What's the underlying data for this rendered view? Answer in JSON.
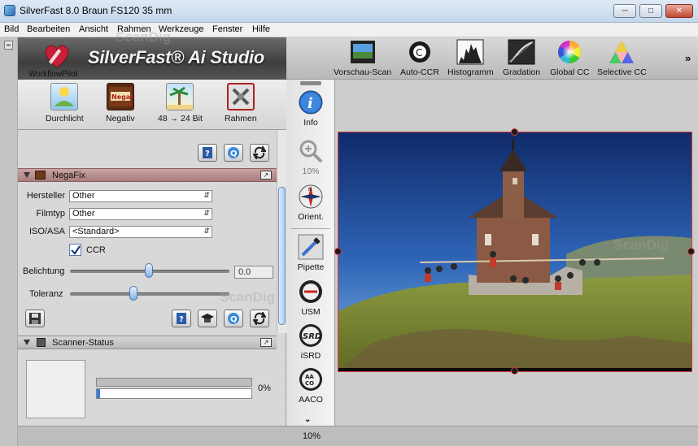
{
  "window": {
    "title": "SilverFast 8.0 Braun FS120 35 mm"
  },
  "menu": [
    "Bild",
    "Bearbeiten",
    "Ansicht",
    "Rahmen",
    "Werkzeuge",
    "Fenster",
    "Hilfe"
  ],
  "brand": {
    "logo_text": "SilverFast® Ai Studio",
    "workflow_label": "WorkflowPilot"
  },
  "toolbar": [
    {
      "label": "Vorschau-Scan",
      "icon": "preview-scan-icon"
    },
    {
      "label": "Auto-CCR",
      "icon": "auto-ccr-icon"
    },
    {
      "label": "Histogramm",
      "icon": "histogram-icon"
    },
    {
      "label": "Gradation",
      "icon": "gradation-icon"
    },
    {
      "label": "Global CC",
      "icon": "global-cc-icon"
    },
    {
      "label": "Selective CC",
      "icon": "selective-cc-icon"
    }
  ],
  "toolbar_more": "»",
  "scan_modes": [
    {
      "label": "Durchlicht",
      "icon": "transparency-icon"
    },
    {
      "label": "Negativ",
      "icon": "negafix-icon"
    },
    {
      "label": "48 → 24 Bit",
      "icon": "bitdepth-icon"
    },
    {
      "label": "Rahmen",
      "icon": "frame-tools-icon"
    }
  ],
  "negafix": {
    "title": "NegaFix",
    "hersteller_label": "Hersteller",
    "hersteller_value": "Other",
    "filmtyp_label": "Filmtyp",
    "filmtyp_value": "Other",
    "iso_label": "ISO/ASA",
    "iso_value": "<Standard>",
    "ccr_label": "CCR",
    "ccr_checked": true,
    "belichtung_label": "Belichtung",
    "belichtung_value": "0.0",
    "toleranz_label": "Toleranz"
  },
  "scanner_status": {
    "title": "Scanner-Status",
    "progress_text": "0%",
    "progress": 0.0
  },
  "side_tools": [
    {
      "label": "Info",
      "icon": "info-icon"
    },
    {
      "label": "10%",
      "icon": "zoom-icon"
    },
    {
      "label": "Orient.",
      "icon": "compass-icon"
    },
    {
      "label": "Pipette",
      "icon": "pipette-icon"
    },
    {
      "label": "USM",
      "icon": "usm-icon"
    },
    {
      "label": "iSRD",
      "icon": "isrd-icon"
    },
    {
      "label": "AACO",
      "icon": "aaco-icon"
    }
  ],
  "zoom_status": "10%",
  "watermark": "ScanDig",
  "colors": {
    "accent_red": "#d23c3c",
    "section_header": "#b48a8a"
  }
}
